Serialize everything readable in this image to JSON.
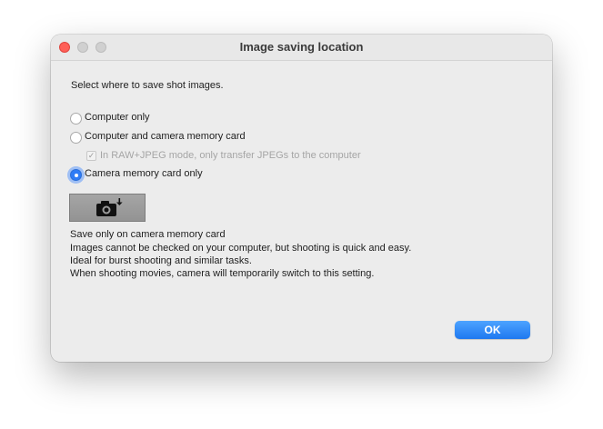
{
  "window": {
    "title": "Image saving location",
    "controls": [
      "close-icon",
      "minimize-icon",
      "zoom-icon"
    ]
  },
  "dialog": {
    "instruction": "Select where to save shot images.",
    "options": [
      {
        "label": "Computer only",
        "selected": false
      },
      {
        "label": "Computer and camera memory card",
        "selected": false
      },
      {
        "label": "Camera memory card only",
        "selected": true
      }
    ],
    "sub_option": {
      "label": "In RAW+JPEG mode, only transfer JPEGs to the computer",
      "checked": true,
      "enabled": false
    },
    "preview_icon": "camera-to-card-icon",
    "description": [
      "Save only on camera memory card",
      "Images cannot be checked on your computer, but shooting is quick and easy.",
      "Ideal for burst shooting and similar tasks.",
      "When shooting movies, camera will temporarily switch to this setting."
    ],
    "ok_label": "OK"
  },
  "colors": {
    "accent": "#2f7cf6",
    "close_button": "#ff5f57",
    "window_bg": "#ececec"
  }
}
